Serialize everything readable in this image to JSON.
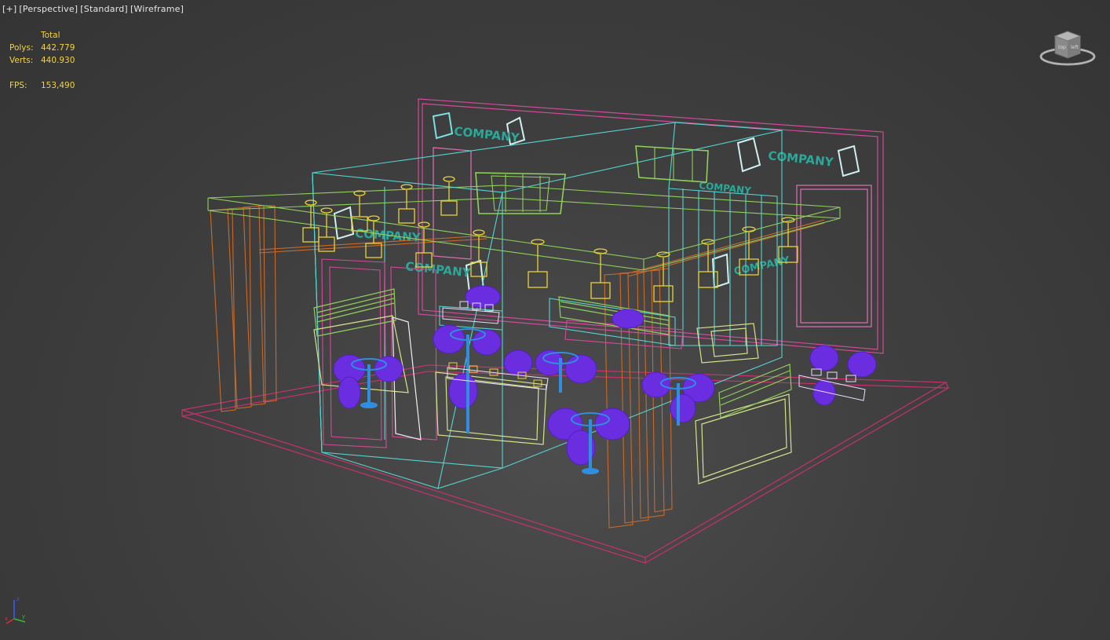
{
  "viewport": {
    "labels": [
      "[+]",
      "[Perspective]",
      "[Standard]",
      "[Wireframe]"
    ]
  },
  "stats": {
    "header": "Total",
    "polys_label": "Polys:",
    "polys_value": "442.779",
    "verts_label": "Verts:",
    "verts_value": "440.930",
    "fps_label": "FPS:",
    "fps_value": "153,490"
  },
  "viewcube": {
    "icon": "viewcube-icon",
    "face_labels": [
      "top",
      "left"
    ]
  },
  "axis": {
    "z": "z",
    "x": "x",
    "y": "y"
  },
  "scene": {
    "signage_text": [
      "COMPANY",
      "COMPANY",
      "COMPANY",
      "COMPANY",
      "COMPANY",
      "COMPANY"
    ]
  },
  "colors": {
    "floor": "#c8306e",
    "frame": "#55d5d0",
    "truss": "#8fd15a",
    "pillar": "#c96a2a",
    "lamp": "#e9d23a",
    "chair": "#6a2de0",
    "table": "#2f8ee0",
    "wall": "#d24a9a",
    "sofa": "#d7e28a",
    "logo": "#2aa89a",
    "stat_text": "#f3d23d"
  }
}
